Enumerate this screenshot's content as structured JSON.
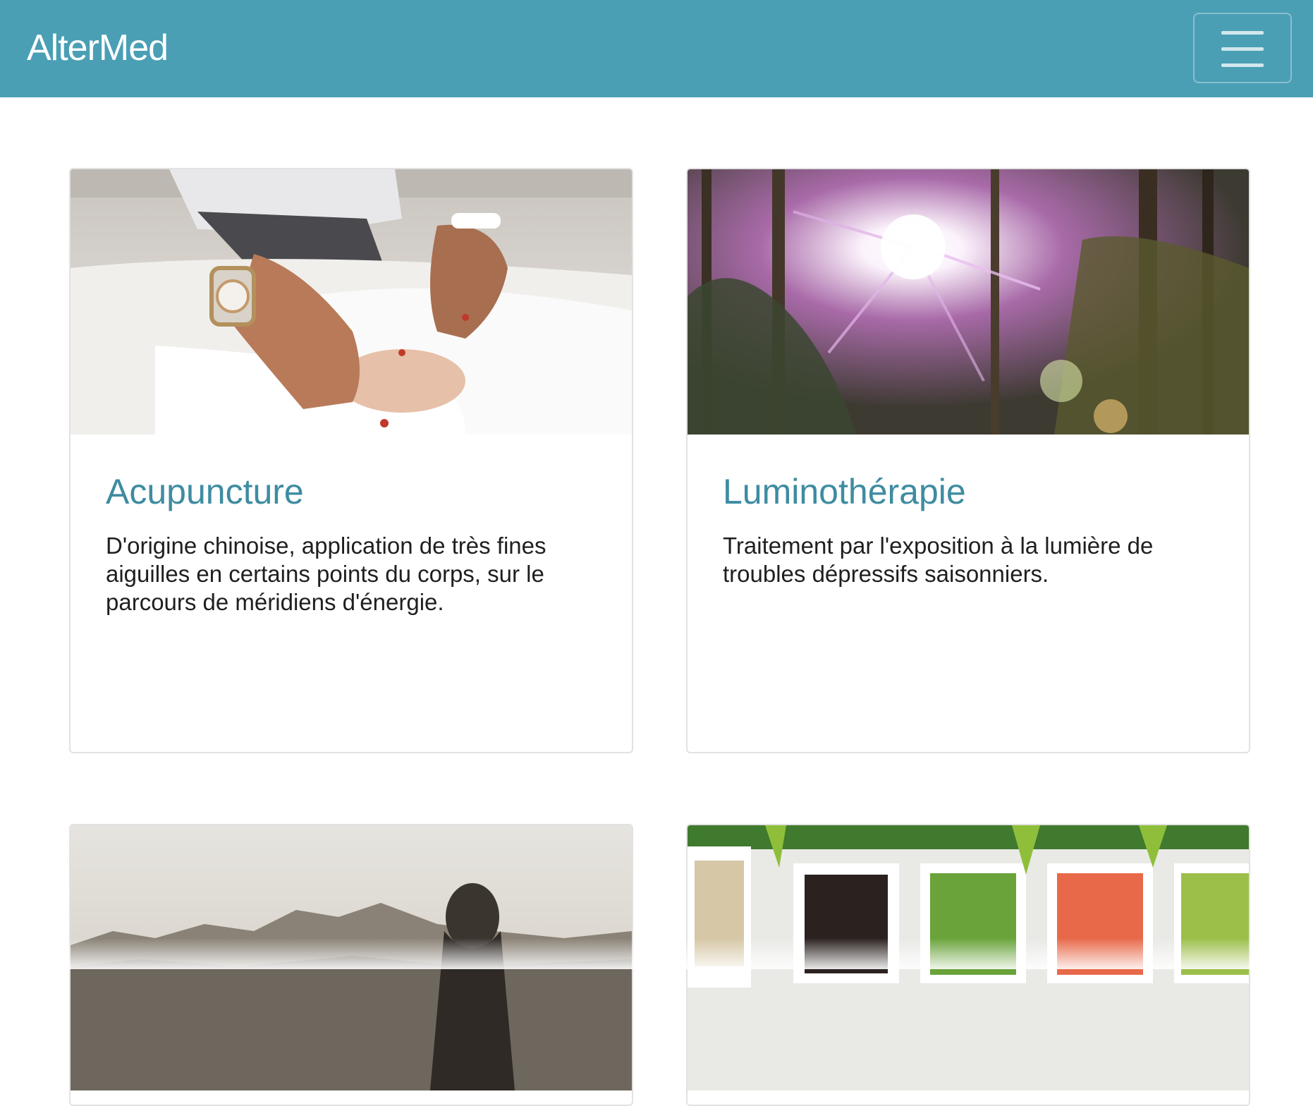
{
  "navbar": {
    "brand": "AlterMed",
    "bg_color": "#4a9fb5",
    "toggler_icon": "hamburger-menu-icon"
  },
  "cards": [
    {
      "title": "Acupuncture",
      "text": "D'origine chinoise, application de très fines aiguilles en certains points du corps, sur le parcours de méridiens d'énergie.",
      "image": "acupuncture-photo"
    },
    {
      "title": "Luminothérapie",
      "text": "Traitement par l'exposition à la lumière de troubles dépressifs saisonniers.",
      "image": "sunlit-forest-photo"
    },
    {
      "image": "mountain-hiker-photo"
    },
    {
      "image": "vegetable-bowls-photo"
    }
  ],
  "accent_color": "#3e8ca1"
}
